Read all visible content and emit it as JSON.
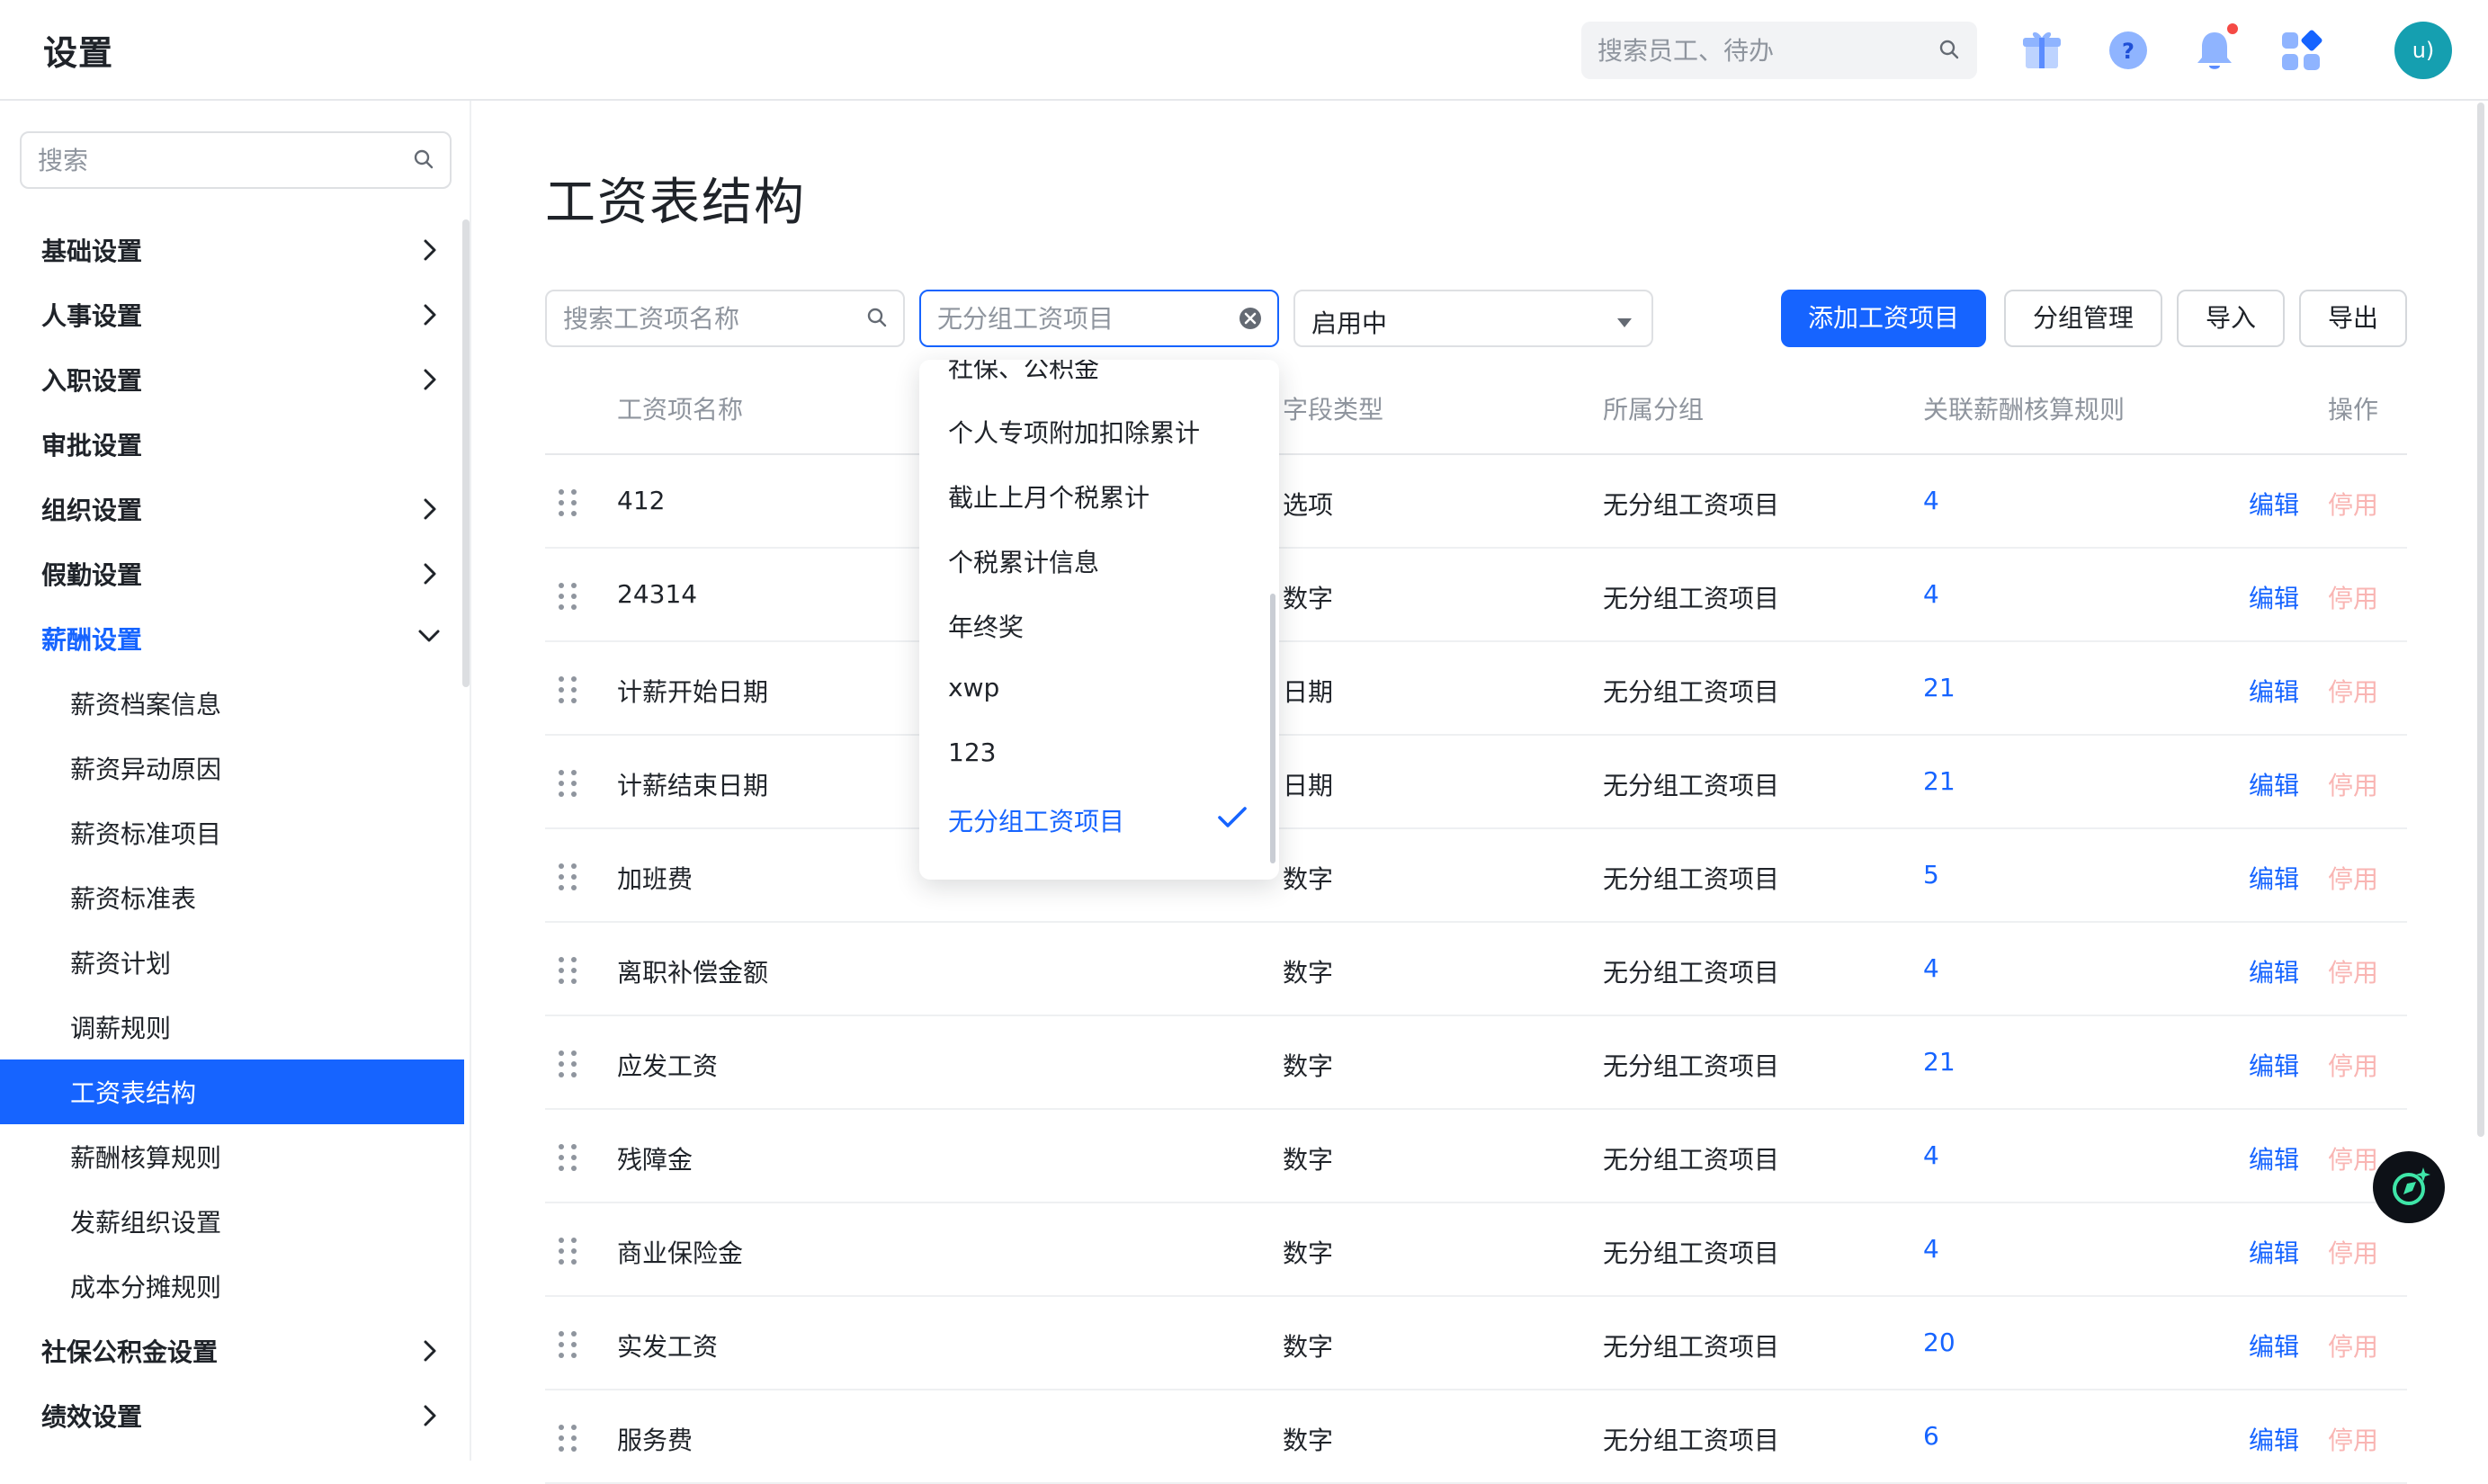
{
  "header": {
    "title": "设置",
    "search_placeholder": "搜索员工、待办",
    "icons": [
      "gift-icon",
      "help-icon",
      "bell-icon",
      "apps-icon"
    ],
    "avatar_text": "u)",
    "colors": {
      "accent": "#1664ff",
      "avatar": "#159fb0",
      "notify": "#f54a45"
    }
  },
  "sidebar": {
    "search_placeholder": "搜索",
    "items": [
      {
        "label": "基础设置",
        "chevron": "right"
      },
      {
        "label": "人事设置",
        "chevron": "right"
      },
      {
        "label": "入职设置",
        "chevron": "right"
      },
      {
        "label": "审批设置",
        "chevron": "none"
      },
      {
        "label": "组织设置",
        "chevron": "right"
      },
      {
        "label": "假勤设置",
        "chevron": "right"
      },
      {
        "label": "薪酬设置",
        "chevron": "down",
        "expanded": true
      },
      {
        "label": "社保公积金设置",
        "chevron": "right"
      },
      {
        "label": "绩效设置",
        "chevron": "right"
      }
    ],
    "sub_items": [
      {
        "label": "薪资档案信息"
      },
      {
        "label": "薪资异动原因"
      },
      {
        "label": "薪资标准项目"
      },
      {
        "label": "薪资标准表"
      },
      {
        "label": "薪资计划"
      },
      {
        "label": "调薪规则"
      },
      {
        "label": "工资表结构",
        "active": true
      },
      {
        "label": "薪酬核算规则"
      },
      {
        "label": "发薪组织设置"
      },
      {
        "label": "成本分摊规则"
      }
    ]
  },
  "main": {
    "title": "工资表结构",
    "filters": {
      "name_placeholder": "搜索工资项名称",
      "group_placeholder": "无分组工资项目",
      "status_value": "启用中"
    },
    "buttons": {
      "add": "添加工资项目",
      "group_manage": "分组管理",
      "import": "导入",
      "export": "导出"
    },
    "columns": [
      "工资项名称",
      "字段类型",
      "所属分组",
      "关联薪酬核算规则",
      "操作"
    ],
    "rows": [
      {
        "name": "412",
        "type": "选项",
        "group": "无分组工资项目",
        "rules": "4",
        "edit": "编辑",
        "disable": "停用"
      },
      {
        "name": "24314",
        "type": "数字",
        "group": "无分组工资项目",
        "rules": "4",
        "edit": "编辑",
        "disable": "停用"
      },
      {
        "name": "计薪开始日期",
        "type": "日期",
        "group": "无分组工资项目",
        "rules": "21",
        "edit": "编辑",
        "disable": "停用"
      },
      {
        "name": "计薪结束日期",
        "type": "日期",
        "group": "无分组工资项目",
        "rules": "21",
        "edit": "编辑",
        "disable": "停用"
      },
      {
        "name": "加班费",
        "type": "数字",
        "group": "无分组工资项目",
        "rules": "5",
        "edit": "编辑",
        "disable": "停用"
      },
      {
        "name": "离职补偿金额",
        "type": "数字",
        "group": "无分组工资项目",
        "rules": "4",
        "edit": "编辑",
        "disable": "停用"
      },
      {
        "name": "应发工资",
        "type": "数字",
        "group": "无分组工资项目",
        "rules": "21",
        "edit": "编辑",
        "disable": "停用"
      },
      {
        "name": "残障金",
        "type": "数字",
        "group": "无分组工资项目",
        "rules": "4",
        "edit": "编辑",
        "disable": "停用"
      },
      {
        "name": "商业保险金",
        "type": "数字",
        "group": "无分组工资项目",
        "rules": "4",
        "edit": "编辑",
        "disable": "停用"
      },
      {
        "name": "实发工资",
        "type": "数字",
        "group": "无分组工资项目",
        "rules": "20",
        "edit": "编辑",
        "disable": "停用"
      },
      {
        "name": "服务费",
        "type": "数字",
        "group": "无分组工资项目",
        "rules": "6",
        "edit": "编辑",
        "disable": "停用"
      }
    ]
  },
  "dropdown": {
    "options": [
      {
        "label": "社保、公积金"
      },
      {
        "label": "个人专项附加扣除累计"
      },
      {
        "label": "截止上月个税累计"
      },
      {
        "label": "个税累计信息"
      },
      {
        "label": "年终奖"
      },
      {
        "label": "xwp"
      },
      {
        "label": "123"
      },
      {
        "label": "无分组工资项目",
        "selected": true
      }
    ]
  }
}
